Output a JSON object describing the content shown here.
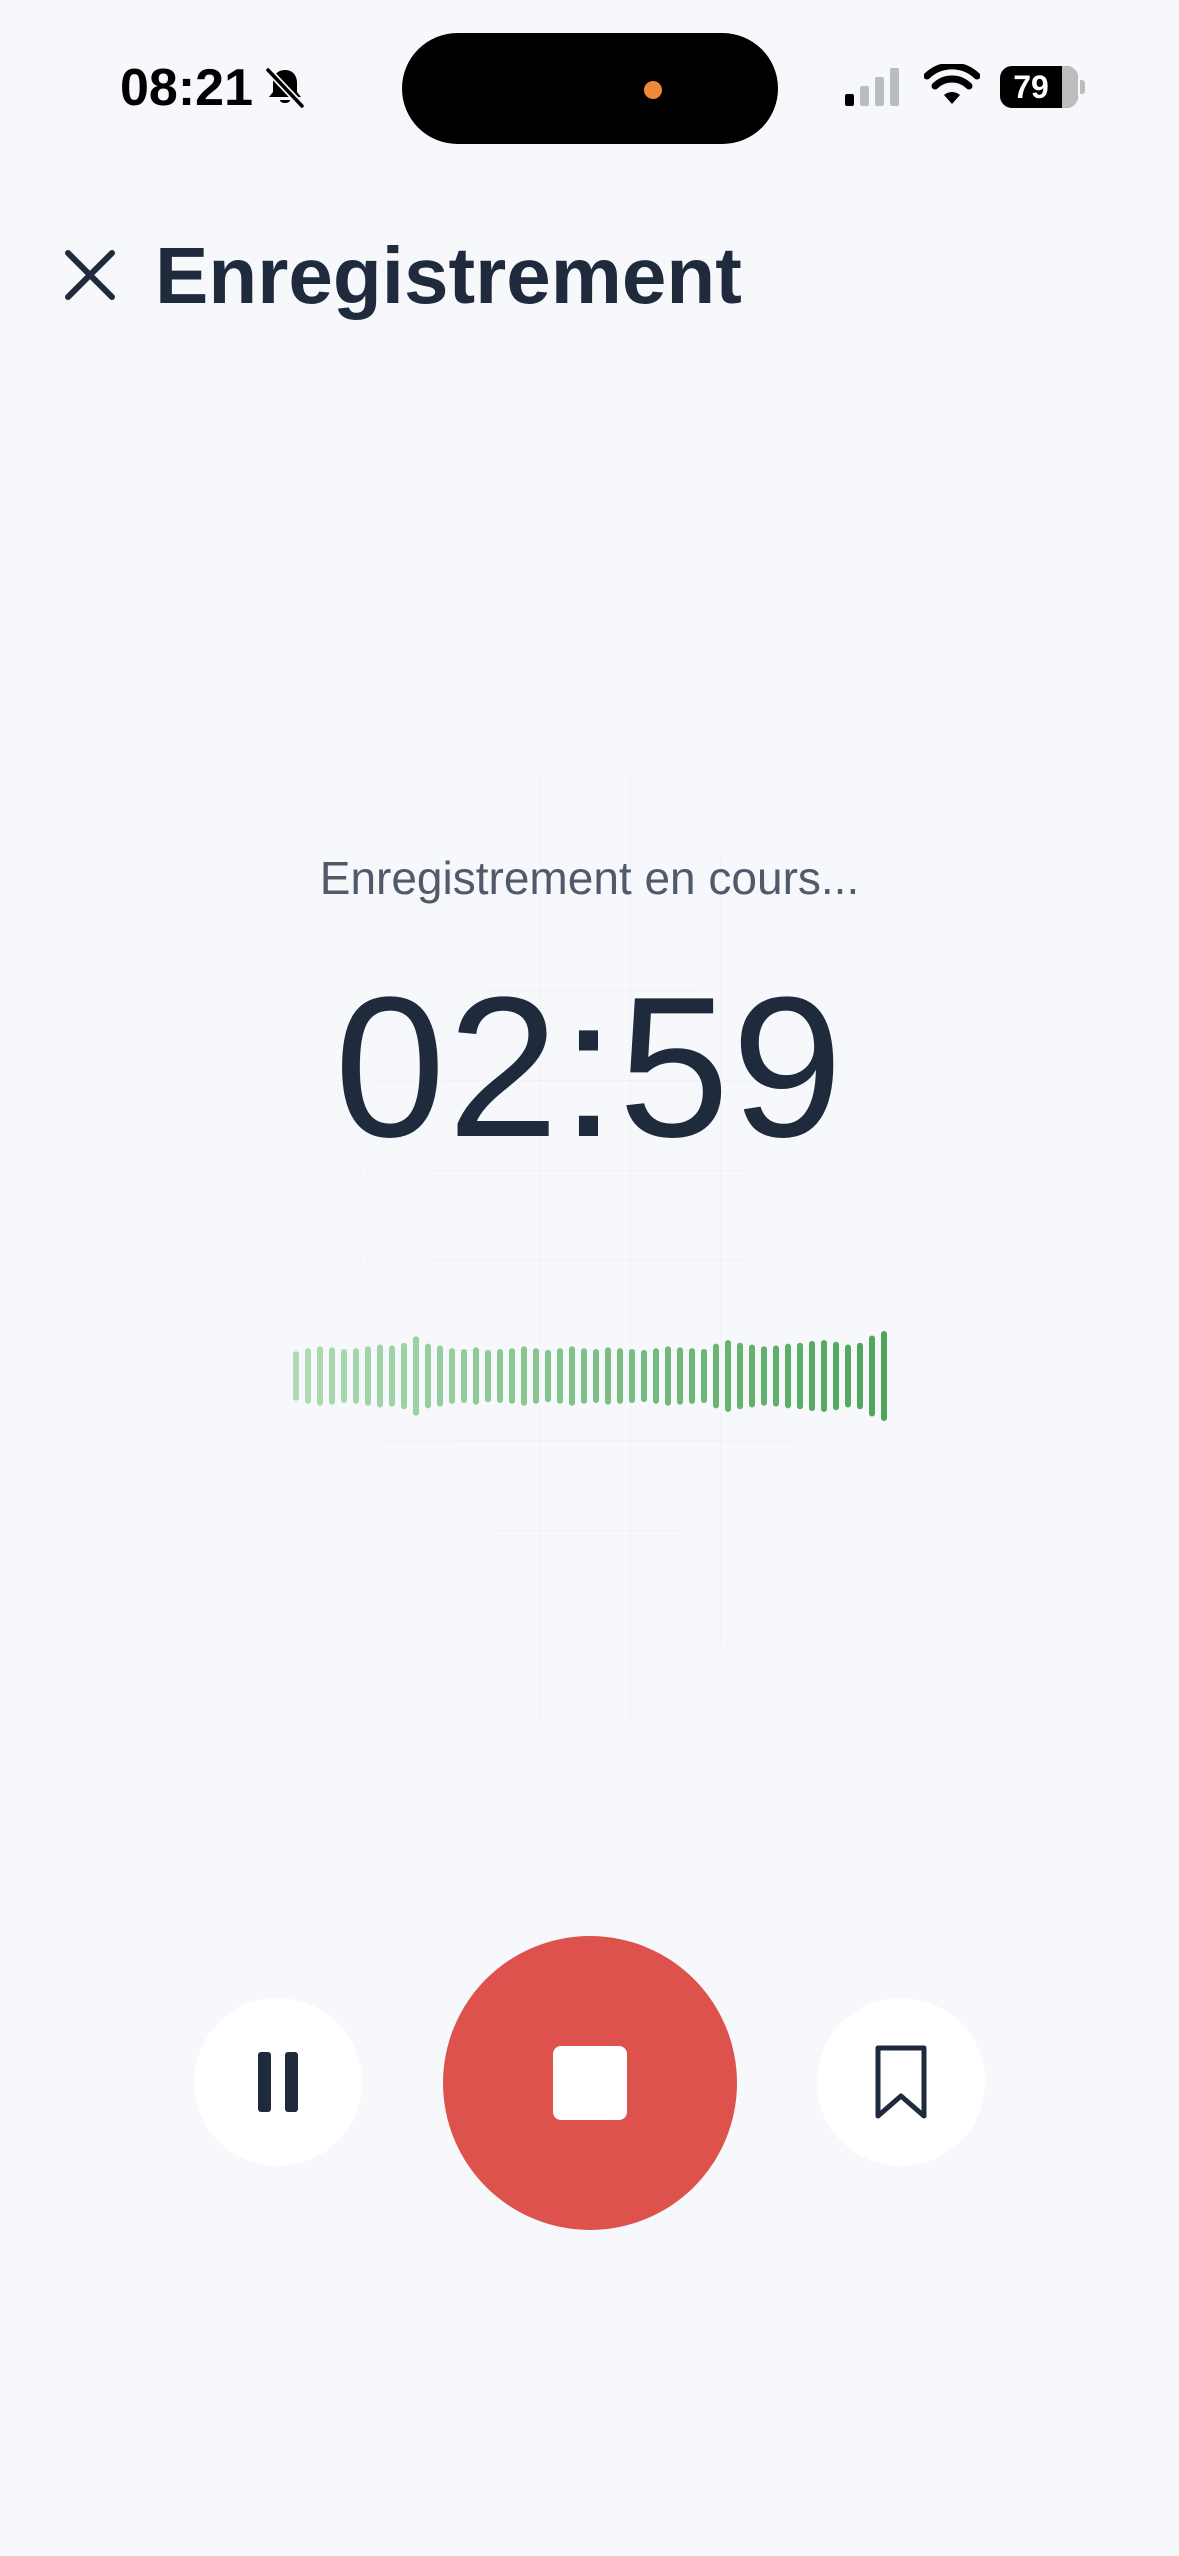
{
  "status_bar": {
    "time": "08:21",
    "battery": "79",
    "battery_level": 0.79,
    "icons": [
      "bell-slash-icon",
      "cellular-signal-icon",
      "wifi-icon",
      "battery-icon"
    ],
    "island_indicator_color": "#f0883a"
  },
  "header": {
    "title": "Enregistrement",
    "close_icon": "close-icon"
  },
  "recording": {
    "status": "Enregistrement en cours...",
    "elapsed": "02:59",
    "waveform_levels": [
      0.55,
      0.62,
      0.66,
      0.64,
      0.6,
      0.62,
      0.66,
      0.7,
      0.68,
      0.74,
      0.88,
      0.72,
      0.68,
      0.62,
      0.6,
      0.64,
      0.58,
      0.6,
      0.62,
      0.66,
      0.62,
      0.58,
      0.62,
      0.66,
      0.62,
      0.6,
      0.64,
      0.62,
      0.6,
      0.58,
      0.62,
      0.66,
      0.64,
      0.62,
      0.6,
      0.72,
      0.8,
      0.74,
      0.7,
      0.66,
      0.68,
      0.72,
      0.74,
      0.78,
      0.8,
      0.76,
      0.7,
      0.74,
      0.9,
      1.0
    ],
    "waveform_color_start": "#aedbb5",
    "waveform_color_end": "#4ea55a"
  },
  "controls": {
    "pause_icon": "pause-icon",
    "stop_icon": "stop-icon",
    "bookmark_icon": "bookmark-icon",
    "stop_color": "#de524d"
  }
}
